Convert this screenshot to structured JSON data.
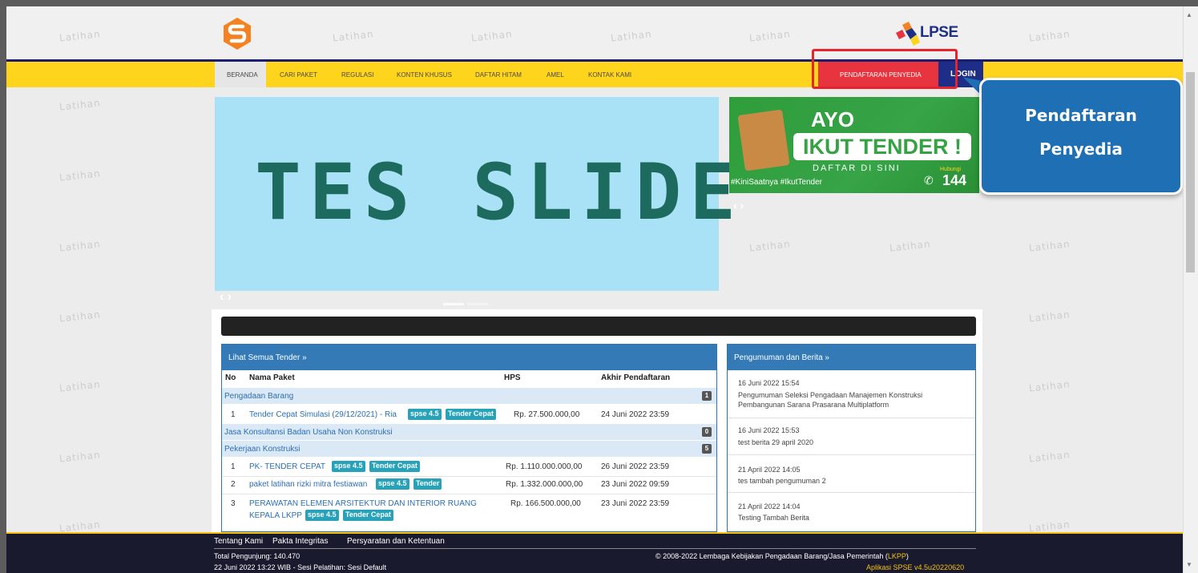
{
  "watermark_text": "Latihan",
  "brand": {
    "lpse_label": "LPSE"
  },
  "nav": {
    "items": [
      "BERANDA",
      "CARI PAKET",
      "REGULASI",
      "KONTEN KHUSUS",
      "DAFTAR HITAM",
      "AMEL",
      "KONTAK KAMI"
    ],
    "register_label": "PENDAFTARAN PENYEDIA",
    "login_label": "LOGIN"
  },
  "slider": {
    "text": "TES SLIDE",
    "arrows": "‹ ›"
  },
  "banner": {
    "ayo": "AYO",
    "ikut_tender": "IKUT TENDER !",
    "daftar": "DAFTAR DI SINI",
    "hashtags": "#KiniSaatnya #IkutTender",
    "hubungi": "Hubungi",
    "phone": "144"
  },
  "callout": {
    "line1": "Pendaftaran",
    "line2": "Penyedia"
  },
  "tender_panel": {
    "title": "Lihat Semua Tender »",
    "columns": [
      "No",
      "Nama Paket",
      "HPS",
      "Akhir Pendaftaran"
    ],
    "categories": [
      {
        "name": "Pengadaan Barang",
        "count": "1"
      },
      {
        "name": "Jasa Konsultansi Badan Usaha Non Konstruksi",
        "count": "0"
      },
      {
        "name": "Pekerjaan Konstruksi",
        "count": "5"
      }
    ],
    "rows": [
      {
        "no": "1",
        "name": "Tender Cepat Simulasi (29/12/2021) - Ria",
        "tags": [
          "spse 4.5",
          "Tender Cepat"
        ],
        "hps": "Rp. 27.500.000,00",
        "deadline": "24 Juni 2022 23:59"
      },
      {
        "no": "1",
        "name": "PK- TENDER CEPAT",
        "tags": [
          "spse 4.5",
          "Tender Cepat"
        ],
        "hps": "Rp. 1.110.000.000,00",
        "deadline": "26 Juni 2022 23:59"
      },
      {
        "no": "2",
        "name": "paket latihan rizki mitra festiawan",
        "tags": [
          "spse 4.5",
          "Tender"
        ],
        "hps": "Rp. 1.332.000.000,00",
        "deadline": "23 Juni 2022 09:59"
      },
      {
        "no": "3",
        "name": "PERAWATAN ELEMEN ARSITEKTUR DAN INTERIOR RUANG",
        "name2": "KEPALA LKPP",
        "tags": [
          "spse 4.5",
          "Tender Cepat"
        ],
        "hps": "Rp. 166.500.000,00",
        "deadline": "23 Juni 2022 23:59"
      }
    ]
  },
  "news_panel": {
    "title": "Pengumuman dan Berita »",
    "items": [
      {
        "date": "16 Juni 2022 15:54",
        "title": "Pengumuman Seleksi Pengadaan Manajemen Konstruksi Pembangunan Sarana Prasarana Multiplatform"
      },
      {
        "date": "16 Juni 2022 15:53",
        "title": "test berita 29 april 2020"
      },
      {
        "date": "21 April 2022 14:05",
        "title": "tes tambah pengumuman 2"
      },
      {
        "date": "21 April 2022 14:04",
        "title": "Testing Tambah Berita"
      }
    ]
  },
  "footer": {
    "links": [
      "Tentang Kami",
      "Pakta Integritas",
      "Persyaratan dan Ketentuan"
    ],
    "visitors": "Total Pengunjung: 140.470",
    "session": "22 Juni 2022 13:22 WIB - Sesi Pelatihan: Sesi Default",
    "copyright_prefix": "© 2008-2022 Lembaga Kebijakan Pengadaan Barang/Jasa Pemerintah (",
    "copyright_link": "LKPP",
    "copyright_suffix": ")",
    "version": "Aplikasi SPSE v4.5u20220620"
  },
  "colors": {
    "nav_yellow": "#ffd41c",
    "nav_navy": "#1a1d6b",
    "register_red": "#e7343f",
    "panel_blue": "#337ab7",
    "tag_teal": "#27a2b8",
    "callout_blue": "#1f6fb5"
  }
}
